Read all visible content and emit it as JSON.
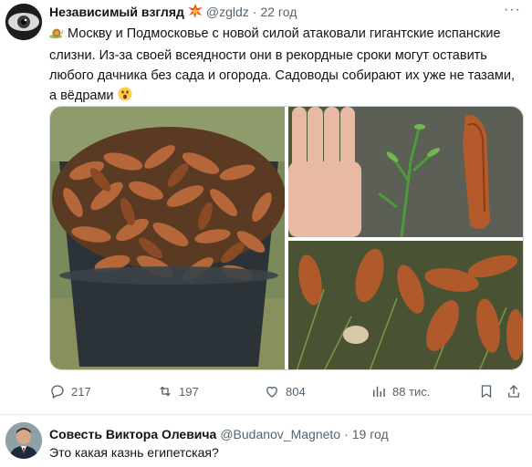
{
  "tweet": {
    "author_name": "Независимый взгляд",
    "badge_icon": "collision-emoji",
    "handle": "@zgldz",
    "separator": "·",
    "time": "22 год",
    "text": "Москву и Подмосковье с новой силой атаковали гигантские испанские слизни. Из-за своей всеядности они в рекордные сроки могут оставить любого дачника без сада и огорода. Садоводы собирают их уже не тазами, а вёдрами",
    "lead_icon": "snail-emoji",
    "end_icon": "astonished-face-emoji",
    "media": [
      {
        "alt": "bucket-of-slugs-photo"
      },
      {
        "alt": "hand-and-slug-photo"
      },
      {
        "alt": "slugs-on-grass-photo"
      }
    ],
    "actions": {
      "replies": "217",
      "retweets": "197",
      "likes": "804",
      "views": "88 тис."
    }
  },
  "reply": {
    "author_name": "Совесть Виктора Олевича",
    "handle": "@Budanov_Magneto",
    "separator": "·",
    "time": "19 год",
    "text": "Это какая казнь египетская?"
  },
  "colors": {
    "text_primary": "#0f1419",
    "text_secondary": "#536471",
    "divider": "#e6ecf0"
  }
}
